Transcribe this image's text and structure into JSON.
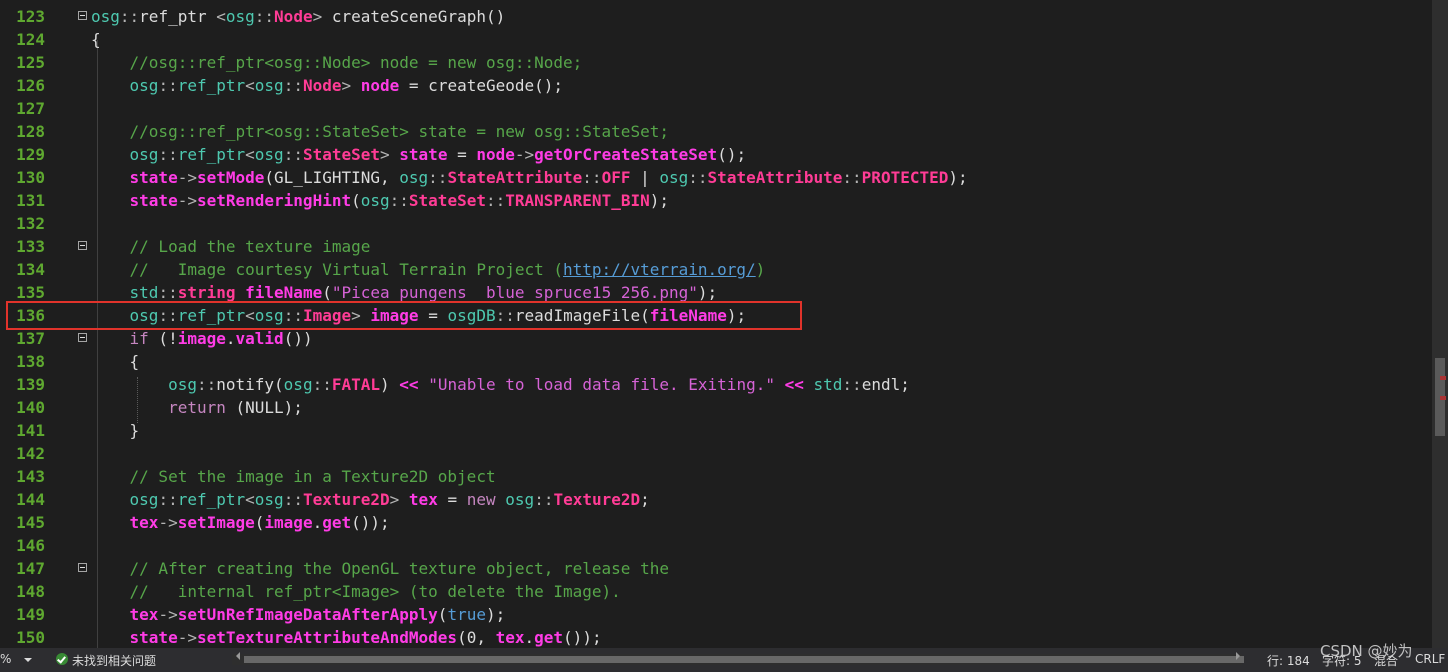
{
  "editor": {
    "lines": [
      {
        "n": "123",
        "tokens": [
          [
            "ns",
            "osg"
          ],
          [
            "op",
            "::"
          ],
          [
            "fn",
            "ref_ptr "
          ],
          [
            "op",
            "<"
          ],
          [
            "ns",
            "osg"
          ],
          [
            "op",
            "::"
          ],
          [
            "ty",
            "Node"
          ],
          [
            "op",
            "> "
          ],
          [
            "fn",
            "createSceneGraph()"
          ]
        ]
      },
      {
        "n": "124",
        "tokens": [
          [
            "fn",
            "{"
          ]
        ]
      },
      {
        "n": "125",
        "tokens": [
          [
            "fn",
            "    "
          ],
          [
            "cm",
            "//osg::ref_ptr<osg::Node> node = new osg::Node;"
          ]
        ]
      },
      {
        "n": "126",
        "tokens": [
          [
            "fn",
            "    "
          ],
          [
            "ns",
            "osg"
          ],
          [
            "op",
            "::"
          ],
          [
            "ns",
            "ref_ptr"
          ],
          [
            "op",
            "<"
          ],
          [
            "ns",
            "osg"
          ],
          [
            "op",
            "::"
          ],
          [
            "ty",
            "Node"
          ],
          [
            "op",
            "> "
          ],
          [
            "var",
            "node"
          ],
          [
            "fn",
            " = createGeode();"
          ]
        ]
      },
      {
        "n": "127",
        "tokens": []
      },
      {
        "n": "128",
        "tokens": [
          [
            "fn",
            "    "
          ],
          [
            "cm",
            "//osg::ref_ptr<osg::StateSet> state = new osg::StateSet;"
          ]
        ]
      },
      {
        "n": "129",
        "tokens": [
          [
            "fn",
            "    "
          ],
          [
            "ns",
            "osg"
          ],
          [
            "op",
            "::"
          ],
          [
            "ns",
            "ref_ptr"
          ],
          [
            "op",
            "<"
          ],
          [
            "ns",
            "osg"
          ],
          [
            "op",
            "::"
          ],
          [
            "ty",
            "StateSet"
          ],
          [
            "op",
            "> "
          ],
          [
            "var",
            "state"
          ],
          [
            "fn",
            " = "
          ],
          [
            "var",
            "node"
          ],
          [
            "op",
            "->"
          ],
          [
            "mth",
            "getOrCreateStateSet"
          ],
          [
            "fn",
            "();"
          ]
        ]
      },
      {
        "n": "130",
        "tokens": [
          [
            "fn",
            "    "
          ],
          [
            "var",
            "state"
          ],
          [
            "op",
            "->"
          ],
          [
            "mth",
            "setMode"
          ],
          [
            "fn",
            "(GL_LIGHTING, "
          ],
          [
            "ns",
            "osg"
          ],
          [
            "op",
            "::"
          ],
          [
            "ty",
            "StateAttribute"
          ],
          [
            "op",
            "::"
          ],
          [
            "ty",
            "OFF"
          ],
          [
            "fn",
            " | "
          ],
          [
            "ns",
            "osg"
          ],
          [
            "op",
            "::"
          ],
          [
            "ty",
            "StateAttribute"
          ],
          [
            "op",
            "::"
          ],
          [
            "ty",
            "PROTECTED"
          ],
          [
            "fn",
            ");"
          ]
        ]
      },
      {
        "n": "131",
        "tokens": [
          [
            "fn",
            "    "
          ],
          [
            "var",
            "state"
          ],
          [
            "op",
            "->"
          ],
          [
            "mth",
            "setRenderingHint"
          ],
          [
            "fn",
            "("
          ],
          [
            "ns",
            "osg"
          ],
          [
            "op",
            "::"
          ],
          [
            "ty",
            "StateSet"
          ],
          [
            "op",
            "::"
          ],
          [
            "ty",
            "TRANSPARENT_BIN"
          ],
          [
            "fn",
            ");"
          ]
        ]
      },
      {
        "n": "132",
        "tokens": []
      },
      {
        "n": "133",
        "fold": true,
        "tokens": [
          [
            "fn",
            "    "
          ],
          [
            "cm",
            "// Load the texture image"
          ]
        ]
      },
      {
        "n": "134",
        "tokens": [
          [
            "fn",
            "    "
          ],
          [
            "cm",
            "//   Image courtesy Virtual Terrain Project ("
          ],
          [
            "url",
            "http://vterrain.org/"
          ],
          [
            "cm",
            ")"
          ]
        ]
      },
      {
        "n": "135",
        "tokens": [
          [
            "fn",
            "    "
          ],
          [
            "ns",
            "std"
          ],
          [
            "op",
            "::"
          ],
          [
            "ty",
            "string"
          ],
          [
            "fn",
            " "
          ],
          [
            "var",
            "fileName"
          ],
          [
            "fn",
            "("
          ],
          [
            "st",
            "\"Picea_pungens__blue_spruce15_256.png\""
          ],
          [
            "fn",
            ");"
          ]
        ]
      },
      {
        "n": "136",
        "tokens": [
          [
            "fn",
            "    "
          ],
          [
            "ns",
            "osg"
          ],
          [
            "op",
            "::"
          ],
          [
            "ns",
            "ref_ptr"
          ],
          [
            "op",
            "<"
          ],
          [
            "ns",
            "osg"
          ],
          [
            "op",
            "::"
          ],
          [
            "ty",
            "Image"
          ],
          [
            "op",
            "> "
          ],
          [
            "var",
            "image"
          ],
          [
            "fn",
            " = "
          ],
          [
            "ns",
            "osgDB"
          ],
          [
            "op",
            "::"
          ],
          [
            "fn",
            "readImageFile("
          ],
          [
            "var",
            "fileName"
          ],
          [
            "fn",
            ");"
          ]
        ]
      },
      {
        "n": "137",
        "fold": true,
        "tokens": [
          [
            "fn",
            "    "
          ],
          [
            "kw",
            "if"
          ],
          [
            "fn",
            " (!"
          ],
          [
            "var",
            "image"
          ],
          [
            "fn",
            "."
          ],
          [
            "mth",
            "valid"
          ],
          [
            "fn",
            "())"
          ]
        ]
      },
      {
        "n": "138",
        "tokens": [
          [
            "fn",
            "    {"
          ]
        ]
      },
      {
        "n": "139",
        "tokens": [
          [
            "fn",
            "        "
          ],
          [
            "ns",
            "osg"
          ],
          [
            "op",
            "::"
          ],
          [
            "fn",
            "notify("
          ],
          [
            "ns",
            "osg"
          ],
          [
            "op",
            "::"
          ],
          [
            "ty",
            "FATAL"
          ],
          [
            "fn",
            ") "
          ],
          [
            "mth",
            "<<"
          ],
          [
            "fn",
            " "
          ],
          [
            "st",
            "\"Unable to load data file. Exiting.\""
          ],
          [
            "fn",
            " "
          ],
          [
            "mth",
            "<<"
          ],
          [
            "fn",
            " "
          ],
          [
            "ns",
            "std"
          ],
          [
            "op",
            "::"
          ],
          [
            "fn",
            "endl;"
          ]
        ]
      },
      {
        "n": "140",
        "tokens": [
          [
            "fn",
            "        "
          ],
          [
            "kw",
            "return"
          ],
          [
            "fn",
            " (NULL);"
          ]
        ]
      },
      {
        "n": "141",
        "tokens": [
          [
            "fn",
            "    }"
          ]
        ]
      },
      {
        "n": "142",
        "tokens": []
      },
      {
        "n": "143",
        "tokens": [
          [
            "fn",
            "    "
          ],
          [
            "cm",
            "// Set the image in a Texture2D object"
          ]
        ]
      },
      {
        "n": "144",
        "tokens": [
          [
            "fn",
            "    "
          ],
          [
            "ns",
            "osg"
          ],
          [
            "op",
            "::"
          ],
          [
            "ns",
            "ref_ptr"
          ],
          [
            "op",
            "<"
          ],
          [
            "ns",
            "osg"
          ],
          [
            "op",
            "::"
          ],
          [
            "ty",
            "Texture2D"
          ],
          [
            "op",
            "> "
          ],
          [
            "var",
            "tex"
          ],
          [
            "fn",
            " = "
          ],
          [
            "kw",
            "new"
          ],
          [
            "fn",
            " "
          ],
          [
            "ns",
            "osg"
          ],
          [
            "op",
            "::"
          ],
          [
            "ty",
            "Texture2D"
          ],
          [
            "fn",
            ";"
          ]
        ]
      },
      {
        "n": "145",
        "tokens": [
          [
            "fn",
            "    "
          ],
          [
            "var",
            "tex"
          ],
          [
            "op",
            "->"
          ],
          [
            "mth",
            "setImage"
          ],
          [
            "fn",
            "("
          ],
          [
            "var",
            "image"
          ],
          [
            "fn",
            "."
          ],
          [
            "mth",
            "get"
          ],
          [
            "fn",
            "());"
          ]
        ]
      },
      {
        "n": "146",
        "tokens": []
      },
      {
        "n": "147",
        "fold": true,
        "tokens": [
          [
            "fn",
            "    "
          ],
          [
            "cm",
            "// After creating the OpenGL texture object, release the"
          ]
        ]
      },
      {
        "n": "148",
        "tokens": [
          [
            "fn",
            "    "
          ],
          [
            "cm",
            "//   internal ref_ptr<Image> (to delete the Image)."
          ]
        ]
      },
      {
        "n": "149",
        "tokens": [
          [
            "fn",
            "    "
          ],
          [
            "var",
            "tex"
          ],
          [
            "op",
            "->"
          ],
          [
            "mth",
            "setUnRefImageDataAfterApply"
          ],
          [
            "fn",
            "("
          ],
          [
            "kwb",
            "true"
          ],
          [
            "fn",
            ");"
          ]
        ]
      },
      {
        "n": "150",
        "tokens": [
          [
            "fn",
            "    "
          ],
          [
            "var",
            "state"
          ],
          [
            "op",
            "->"
          ],
          [
            "mth",
            "setTextureAttributeAndModes"
          ],
          [
            "fn",
            "(0, "
          ],
          [
            "var",
            "tex"
          ],
          [
            "fn",
            "."
          ],
          [
            "mth",
            "get"
          ],
          [
            "fn",
            "());"
          ]
        ]
      }
    ]
  },
  "status": {
    "zoom": "%",
    "issues": "未找到相关问题",
    "line": "行: 184",
    "char": "字符: 5",
    "mixed": "混合",
    "eol": "CRLF"
  },
  "watermark": "CSDN @妙为"
}
